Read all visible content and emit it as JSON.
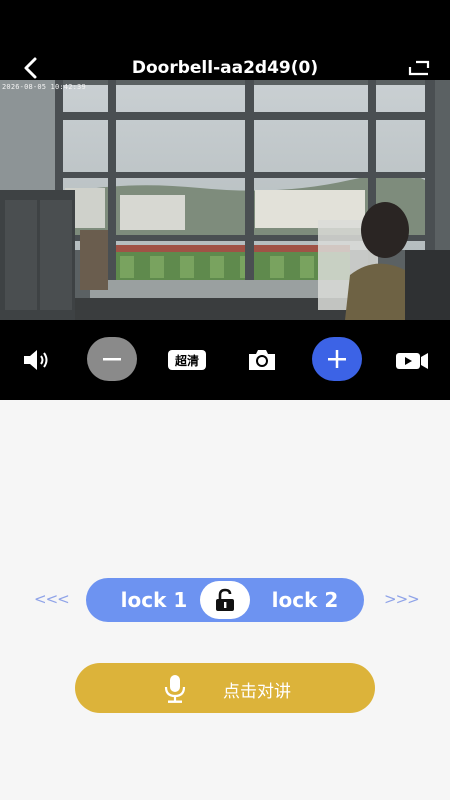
{
  "header": {
    "title": "Doorbell-aa2d49(0)",
    "back_icon": "chevron-left-icon",
    "fullscreen_icon": "fullscreen-icon"
  },
  "video": {
    "timestamp": "2026-08-05 10:42:39"
  },
  "controls": {
    "volume_icon": "speaker-icon",
    "zoom_out_icon": "minus-icon",
    "quality_label": "超清",
    "snapshot_icon": "camera-icon",
    "zoom_in_icon": "plus-icon",
    "record_icon": "video-record-icon"
  },
  "locks": {
    "prev_arrow": "<<<",
    "lock1_label": "lock 1",
    "lock2_label": "lock 2",
    "next_arrow": ">>>",
    "center_icon": "unlock-icon"
  },
  "talk": {
    "label": "点击对讲",
    "icon": "microphone-icon"
  },
  "colors": {
    "header_bg": "#000000",
    "zoom_in_bg": "#3c63e6",
    "zoom_out_bg": "#8a8a8a",
    "lock_bar_bg": "#6d93f1",
    "talk_bg": "#dcb33a",
    "page_bg": "#f6f6f6"
  }
}
